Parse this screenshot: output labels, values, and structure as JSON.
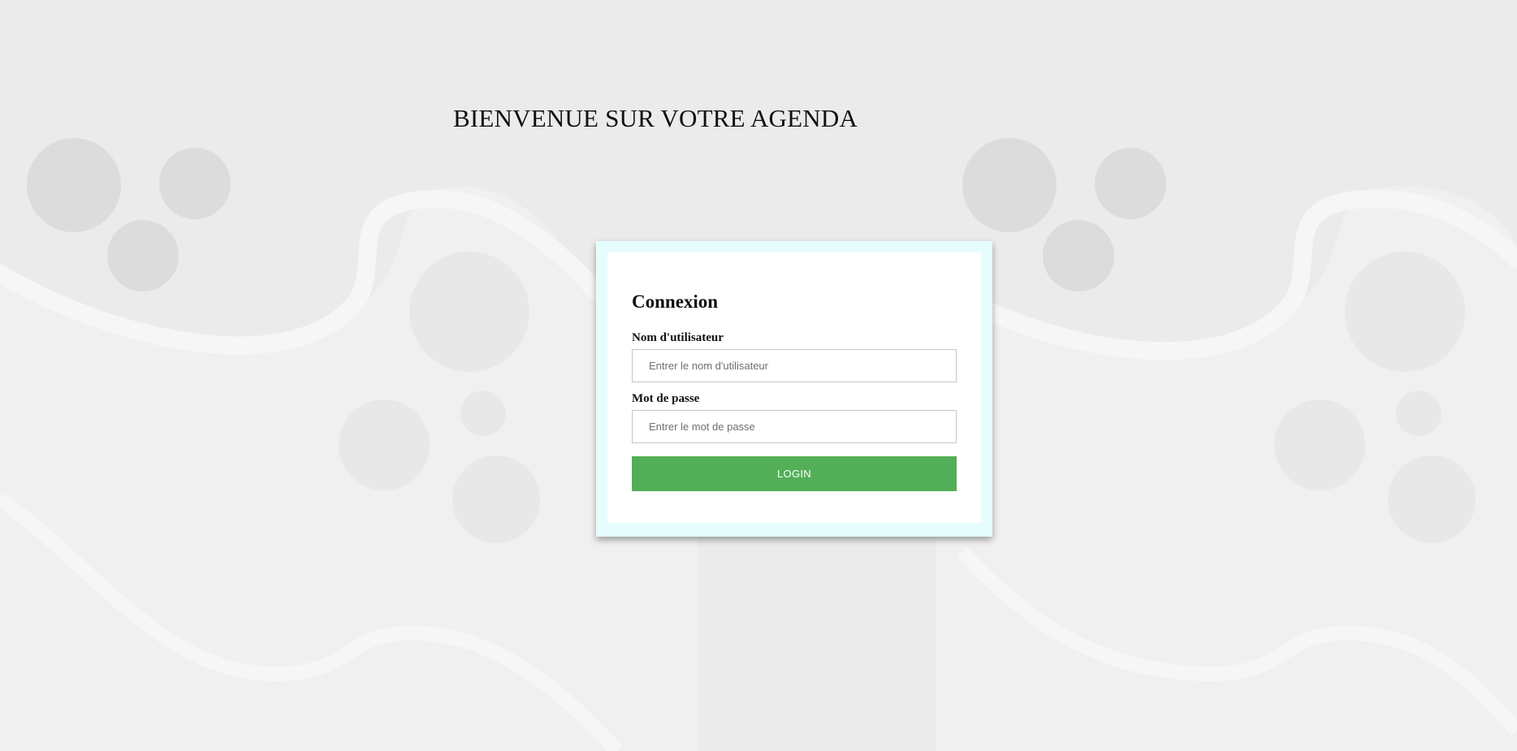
{
  "page": {
    "title": "BIENVENUE SUR VOTRE AGENDA"
  },
  "login_form": {
    "heading": "Connexion",
    "username": {
      "label": "Nom d'utilisateur",
      "placeholder": "Entrer le nom d'utilisateur",
      "value": ""
    },
    "password": {
      "label": "Mot de passe",
      "placeholder": "Entrer le mot de passe",
      "value": ""
    },
    "submit_label": "LOGIN"
  },
  "colors": {
    "background": "#ebebeb",
    "card_border": "#e6fdfd",
    "card": "#ffffff",
    "button": "#53af57",
    "button_text": "#ffffff",
    "decor_circle": "#dcdcdc"
  }
}
